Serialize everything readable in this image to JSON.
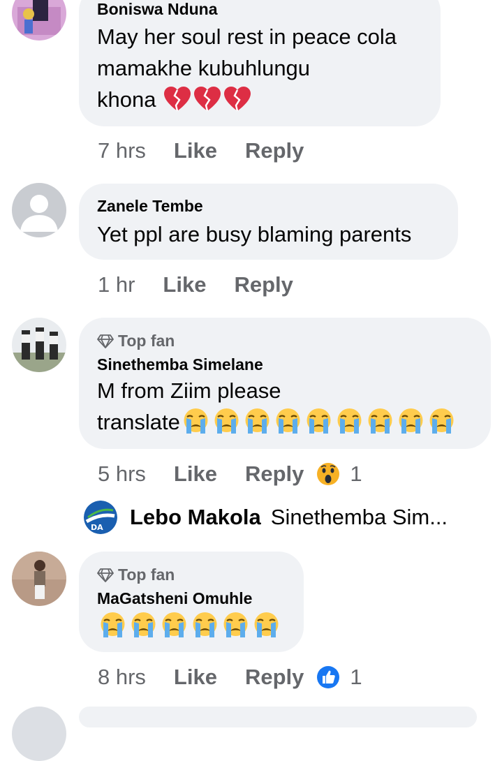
{
  "comments": [
    {
      "author": "Boniswa Nduna",
      "text_lines": [
        "May her soul rest in peace cola",
        "mamakhe kubuhlungu",
        "khona"
      ],
      "text_emoji": "broken-heart x3",
      "time": "7 hrs",
      "like_label": "Like",
      "reply_label": "Reply"
    },
    {
      "author": "Zanele Tembe",
      "text": "Yet ppl are busy blaming parents",
      "time": "1 hr",
      "like_label": "Like",
      "reply_label": "Reply"
    },
    {
      "badge": "Top fan",
      "author": "Sinethemba Simelane",
      "text_lines": [
        "M from Ziim please",
        "translate"
      ],
      "text_emoji": "crying-face x9",
      "time": "5 hrs",
      "like_label": "Like",
      "reply_label": "Reply",
      "reaction": "wow",
      "reaction_count": "1",
      "reply_preview": {
        "author": "Lebo Makola",
        "text": "Sinethemba Sim..."
      }
    },
    {
      "badge": "Top fan",
      "author": "MaGatsheni Omuhle",
      "text_emoji": "crying-face x6",
      "time": "8 hrs",
      "like_label": "Like",
      "reply_label": "Reply",
      "reaction": "like",
      "reaction_count": "1"
    }
  ],
  "colors": {
    "bubble": "#f0f2f5",
    "meta_text": "#65676b",
    "like_blue": "#1877f2"
  }
}
